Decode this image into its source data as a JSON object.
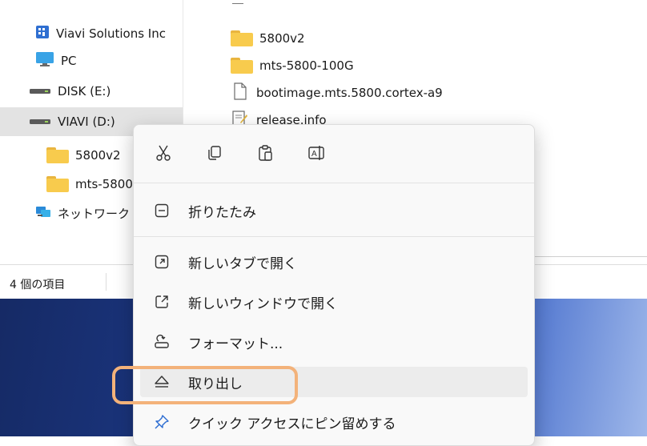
{
  "nav": {
    "items": [
      {
        "label": "Viavi Solutions Inc",
        "icon": "building-icon"
      },
      {
        "label": "PC",
        "icon": "monitor-icon"
      },
      {
        "label": "DISK (E:)",
        "icon": "drive-icon"
      },
      {
        "label": "VIAVI (D:)",
        "icon": "drive-icon"
      },
      {
        "label": "5800v2",
        "icon": "folder-icon"
      },
      {
        "label": "mts-5800",
        "icon": "folder-icon"
      },
      {
        "label": "ネットワーク",
        "icon": "network-icon"
      }
    ]
  },
  "files": [
    {
      "name": "5800v2",
      "icon": "folder-icon"
    },
    {
      "name": "mts-5800-100G",
      "icon": "folder-icon"
    },
    {
      "name": "bootimage.mts.5800.cortex-a9",
      "icon": "file-icon"
    },
    {
      "name": "release.info",
      "icon": "text-file-icon"
    }
  ],
  "status": {
    "item_count": "4 個の項目"
  },
  "context_menu": {
    "toolbar": [
      "cut-icon",
      "copy-icon",
      "paste-icon",
      "rename-icon"
    ],
    "items": [
      {
        "label": "折りたたみ",
        "icon": "collapse-icon"
      },
      {
        "label": "新しいタブで開く",
        "icon": "new-tab-icon"
      },
      {
        "label": "新しいウィンドウで開く",
        "icon": "new-window-icon"
      },
      {
        "label": "フォーマット...",
        "icon": "format-icon"
      },
      {
        "label": "取り出し",
        "icon": "eject-icon"
      },
      {
        "label": "クイック アクセスにピン留めする",
        "icon": "pin-icon"
      }
    ]
  },
  "colors": {
    "highlight": "#f3b27a",
    "folder": "#f8cb4d",
    "accent": "#0067c0"
  }
}
